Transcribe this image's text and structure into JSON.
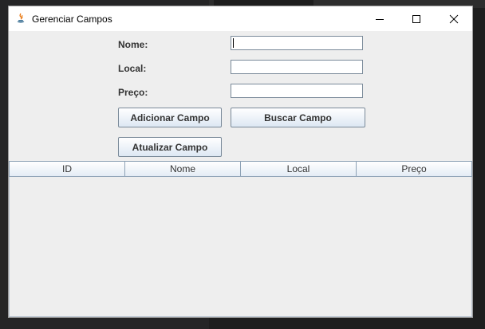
{
  "window": {
    "title": "Gerenciar Campos",
    "controls": {
      "minimize": "minimize-icon",
      "maximize": "maximize-icon",
      "close": "close-icon"
    }
  },
  "form": {
    "nome_label": "Nome:",
    "nome_value": "",
    "local_label": "Local:",
    "local_value": "",
    "preco_label": "Preço:",
    "preco_value": ""
  },
  "buttons": {
    "adicionar": "Adicionar Campo",
    "buscar": "Buscar Campo",
    "atualizar": "Atualizar Campo"
  },
  "table": {
    "columns": [
      "ID",
      "Nome",
      "Local",
      "Preço"
    ],
    "rows": []
  },
  "colors": {
    "window_bg": "#eeeeee",
    "button_gradient_bottom": "#dde8f3",
    "border": "#7a8a99"
  }
}
